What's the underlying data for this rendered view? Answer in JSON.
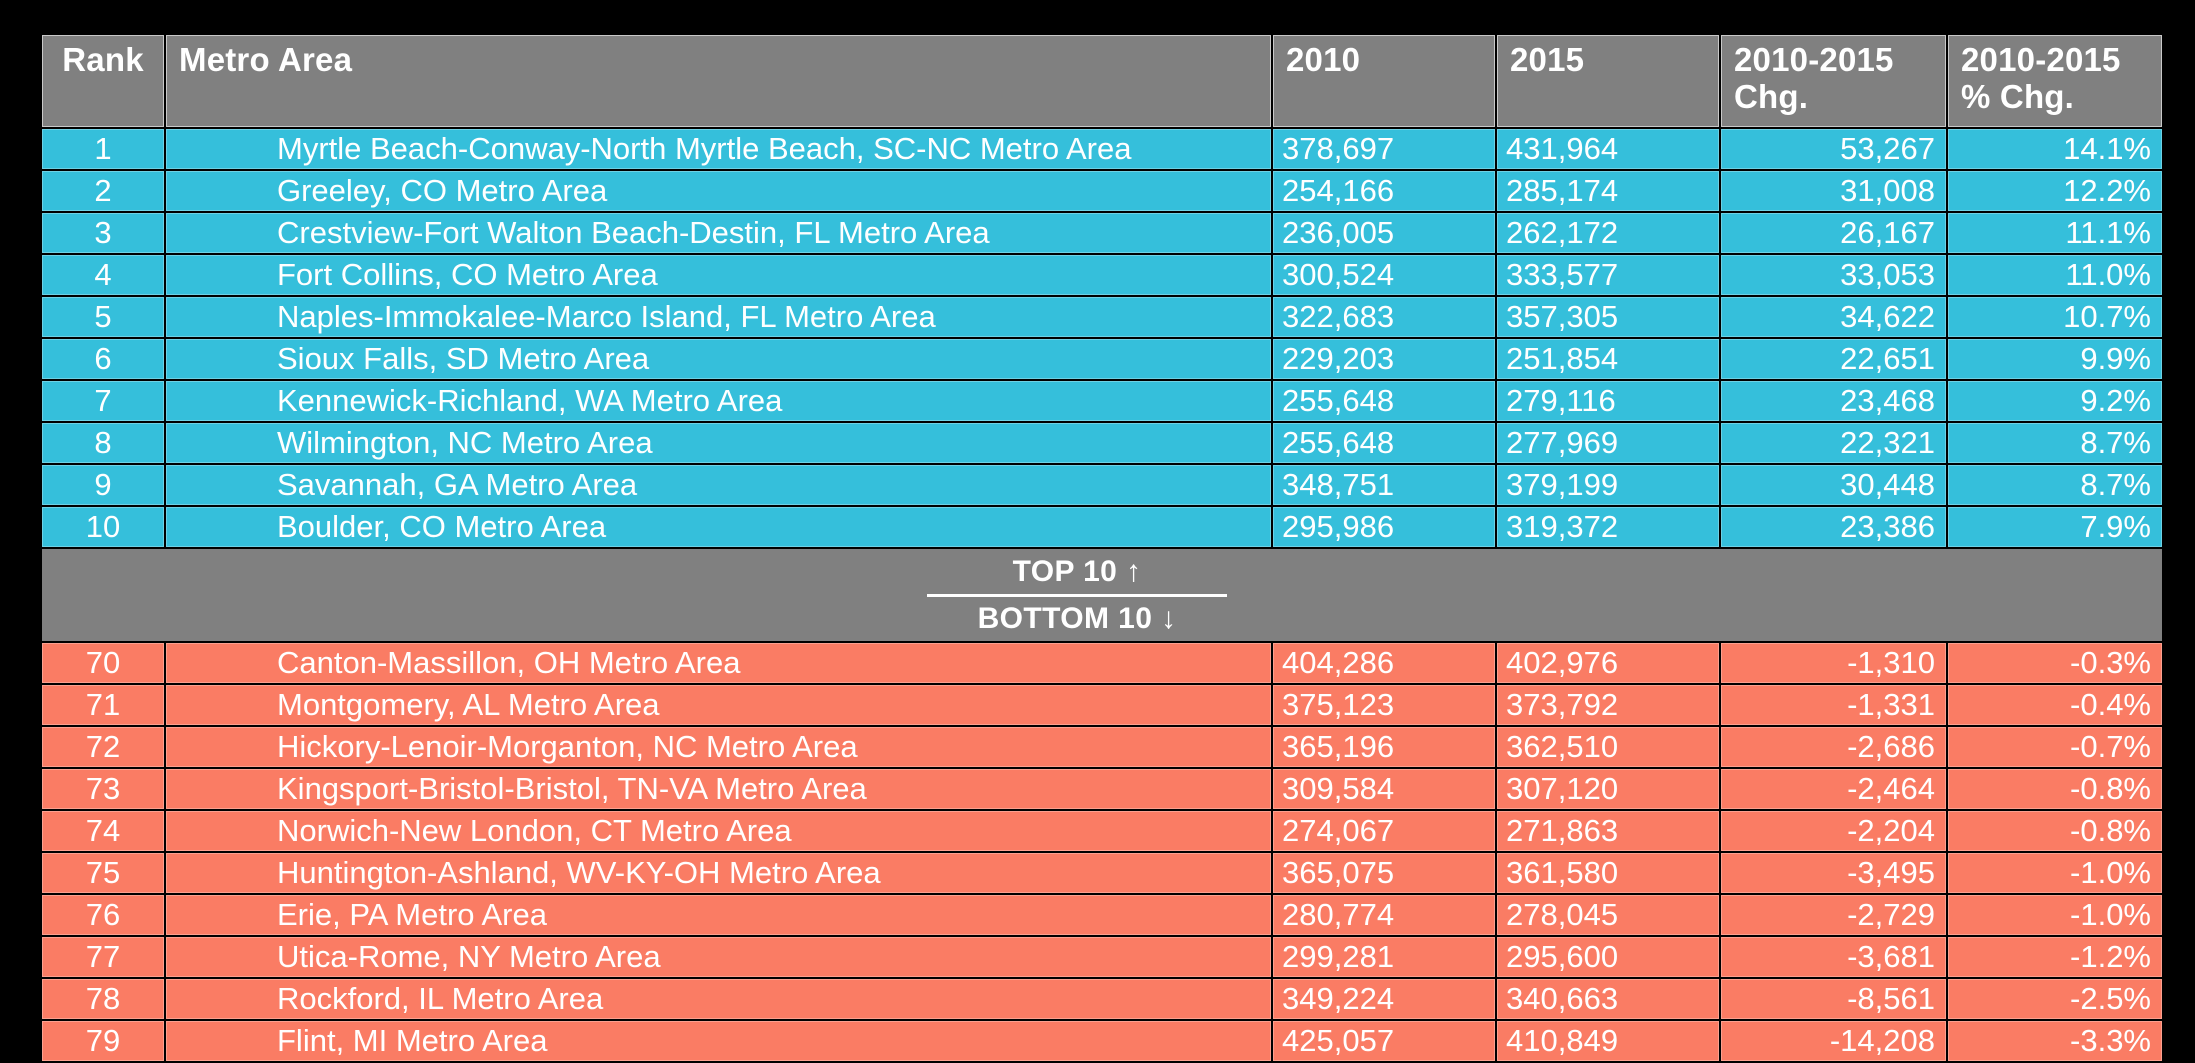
{
  "table": {
    "columns": [
      {
        "key": "rank",
        "label": "Rank"
      },
      {
        "key": "metro",
        "label": "Metro Area"
      },
      {
        "key": "y2010",
        "label": "2010"
      },
      {
        "key": "y2015",
        "label": "2015"
      },
      {
        "key": "chg",
        "label": "2010-2015\nChg."
      },
      {
        "key": "pct",
        "label": "2010-2015\n% Chg."
      }
    ],
    "divider": {
      "top_label": "TOP 10 ↑",
      "bottom_label": "BOTTOM 10 ↓"
    },
    "colors": {
      "header_bg": "#808080",
      "top_row_bg": "#35bfdb",
      "bottom_row_bg": "#fa7c64",
      "text": "#ffffff",
      "page_bg": "#000000",
      "grid_line": "#c9c9c9"
    },
    "top_rows": [
      {
        "rank": "1",
        "metro": "Myrtle Beach-Conway-North Myrtle Beach, SC-NC Metro Area",
        "y2010": "378,697",
        "y2015": "431,964",
        "chg": "53,267",
        "pct": "14.1%"
      },
      {
        "rank": "2",
        "metro": "Greeley, CO Metro Area",
        "y2010": "254,166",
        "y2015": "285,174",
        "chg": "31,008",
        "pct": "12.2%"
      },
      {
        "rank": "3",
        "metro": "Crestview-Fort Walton Beach-Destin, FL Metro Area",
        "y2010": "236,005",
        "y2015": "262,172",
        "chg": "26,167",
        "pct": "11.1%"
      },
      {
        "rank": "4",
        "metro": "Fort Collins, CO Metro Area",
        "y2010": "300,524",
        "y2015": "333,577",
        "chg": "33,053",
        "pct": "11.0%"
      },
      {
        "rank": "5",
        "metro": "Naples-Immokalee-Marco Island, FL Metro Area",
        "y2010": "322,683",
        "y2015": "357,305",
        "chg": "34,622",
        "pct": "10.7%"
      },
      {
        "rank": "6",
        "metro": "Sioux Falls, SD Metro Area",
        "y2010": "229,203",
        "y2015": "251,854",
        "chg": "22,651",
        "pct": "9.9%"
      },
      {
        "rank": "7",
        "metro": "Kennewick-Richland, WA Metro Area",
        "y2010": "255,648",
        "y2015": "279,116",
        "chg": "23,468",
        "pct": "9.2%"
      },
      {
        "rank": "8",
        "metro": "Wilmington, NC Metro Area",
        "y2010": "255,648",
        "y2015": "277,969",
        "chg": "22,321",
        "pct": "8.7%"
      },
      {
        "rank": "9",
        "metro": "Savannah, GA Metro Area",
        "y2010": "348,751",
        "y2015": "379,199",
        "chg": "30,448",
        "pct": "8.7%"
      },
      {
        "rank": "10",
        "metro": "Boulder, CO Metro Area",
        "y2010": "295,986",
        "y2015": "319,372",
        "chg": "23,386",
        "pct": "7.9%"
      }
    ],
    "bottom_rows": [
      {
        "rank": "70",
        "metro": "Canton-Massillon, OH Metro Area",
        "y2010": "404,286",
        "y2015": "402,976",
        "chg": "-1,310",
        "pct": "-0.3%"
      },
      {
        "rank": "71",
        "metro": "Montgomery, AL Metro Area",
        "y2010": "375,123",
        "y2015": "373,792",
        "chg": "-1,331",
        "pct": "-0.4%"
      },
      {
        "rank": "72",
        "metro": "Hickory-Lenoir-Morganton, NC Metro Area",
        "y2010": "365,196",
        "y2015": "362,510",
        "chg": "-2,686",
        "pct": "-0.7%"
      },
      {
        "rank": "73",
        "metro": "Kingsport-Bristol-Bristol, TN-VA Metro Area",
        "y2010": "309,584",
        "y2015": "307,120",
        "chg": "-2,464",
        "pct": "-0.8%"
      },
      {
        "rank": "74",
        "metro": "Norwich-New London, CT Metro Area",
        "y2010": "274,067",
        "y2015": "271,863",
        "chg": "-2,204",
        "pct": "-0.8%"
      },
      {
        "rank": "75",
        "metro": "Huntington-Ashland, WV-KY-OH Metro Area",
        "y2010": "365,075",
        "y2015": "361,580",
        "chg": "-3,495",
        "pct": "-1.0%"
      },
      {
        "rank": "76",
        "metro": "Erie, PA Metro Area",
        "y2010": "280,774",
        "y2015": "278,045",
        "chg": "-2,729",
        "pct": "-1.0%"
      },
      {
        "rank": "77",
        "metro": "Utica-Rome, NY Metro Area",
        "y2010": "299,281",
        "y2015": "295,600",
        "chg": "-3,681",
        "pct": "-1.2%"
      },
      {
        "rank": "78",
        "metro": "Rockford, IL Metro Area",
        "y2010": "349,224",
        "y2015": "340,663",
        "chg": "-8,561",
        "pct": "-2.5%"
      },
      {
        "rank": "79",
        "metro": "Flint, MI Metro Area",
        "y2010": "425,057",
        "y2015": "410,849",
        "chg": "-14,208",
        "pct": "-3.3%"
      }
    ]
  }
}
